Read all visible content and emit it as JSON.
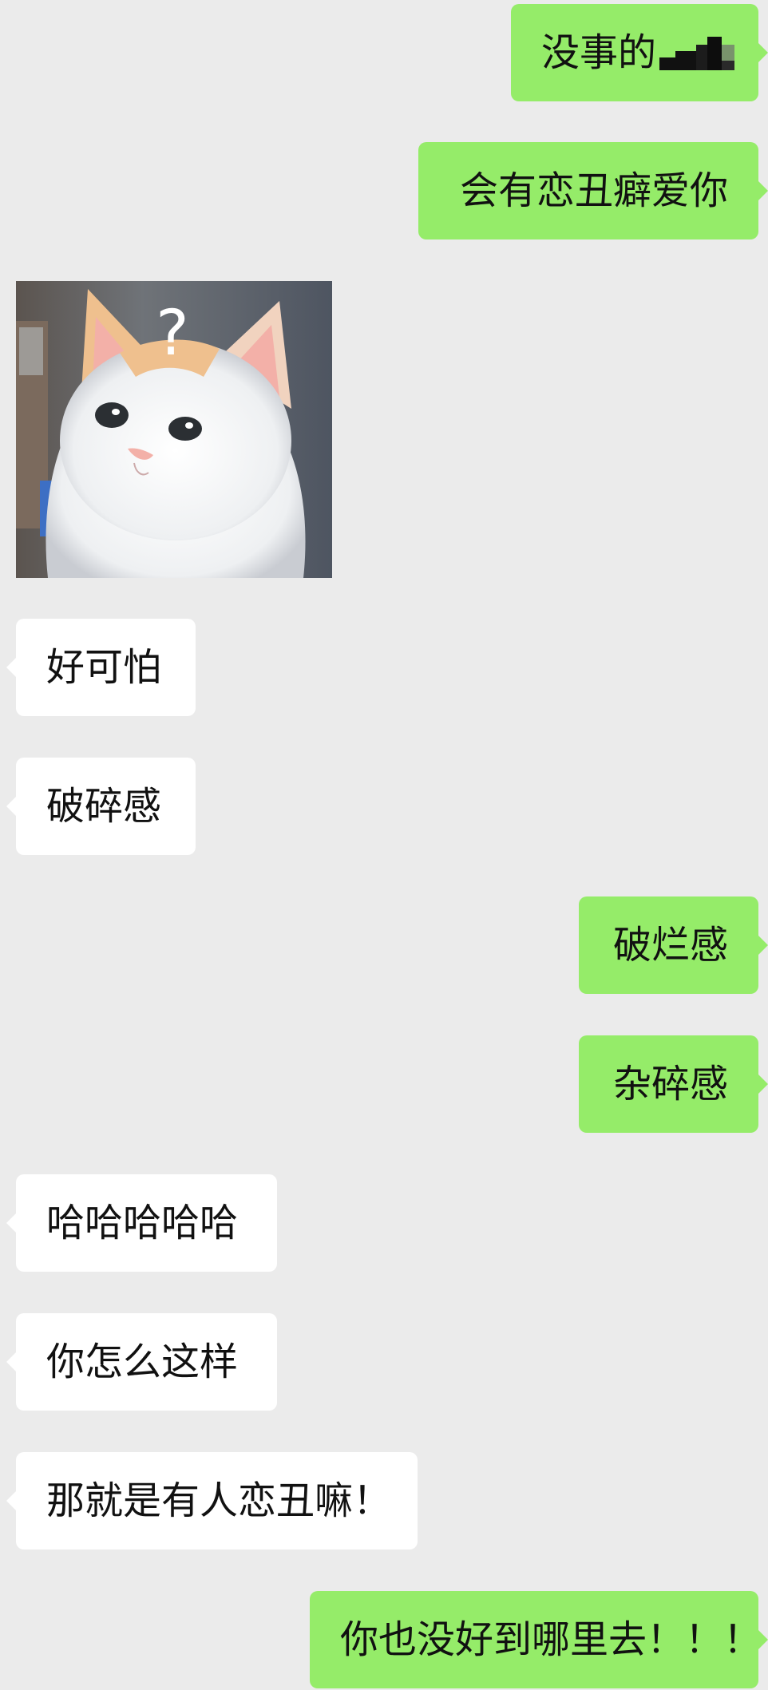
{
  "messages": [
    {
      "side": "right",
      "text": "没事的",
      "has_redaction": true
    },
    {
      "side": "right",
      "text": "会有恋丑癖爱你"
    },
    {
      "side": "left",
      "type": "sticker",
      "sticker_icon": "confused-cat-sticker",
      "sticker_text": "?"
    },
    {
      "side": "left",
      "text": "好可怕"
    },
    {
      "side": "left",
      "text": "破碎感"
    },
    {
      "side": "right",
      "text": "破烂感"
    },
    {
      "side": "right",
      "text": "杂碎感"
    },
    {
      "side": "left",
      "text": "哈哈哈哈哈"
    },
    {
      "side": "left",
      "text": "你怎么这样"
    },
    {
      "side": "left",
      "text": "那就是有人恋丑嘛！"
    },
    {
      "side": "right",
      "text": "你也没好到哪里去！！！"
    }
  ],
  "colors": {
    "background": "#ebebeb",
    "outgoing_bubble": "#95ec69",
    "incoming_bubble": "#ffffff",
    "text": "#111111"
  }
}
